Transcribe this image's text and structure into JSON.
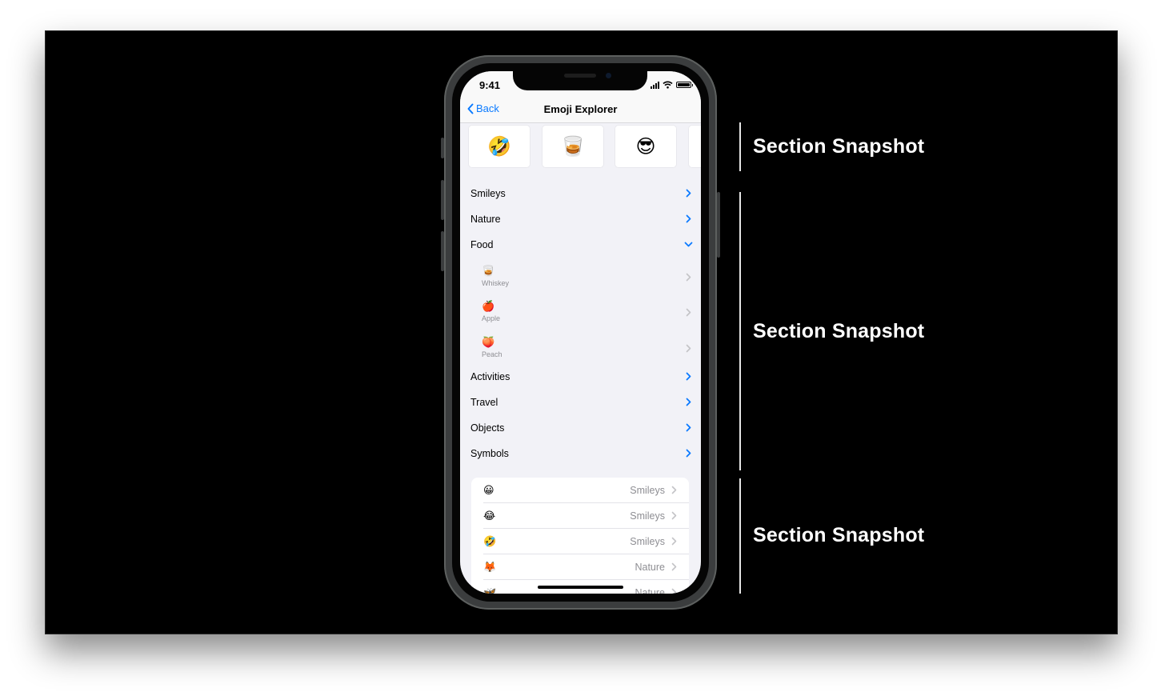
{
  "annotations": {
    "labels": [
      "Section Snapshot",
      "Section Snapshot",
      "Section Snapshot"
    ]
  },
  "phone": {
    "status_time": "9:41",
    "nav": {
      "back_label": "Back",
      "title": "Emoji Explorer"
    },
    "snapshot_cards": [
      "🤣",
      "🥃",
      "😎"
    ],
    "categories": [
      "Smileys",
      "Nature",
      "Food",
      "Activities",
      "Travel",
      "Objects",
      "Symbols"
    ],
    "food_items": [
      {
        "emoji": "🥃",
        "name": "Whiskey"
      },
      {
        "emoji": "🍎",
        "name": "Apple"
      },
      {
        "emoji": "🍑",
        "name": "Peach"
      }
    ],
    "list_rows": [
      {
        "emoji": "😀",
        "category": "Smileys"
      },
      {
        "emoji": "😂",
        "category": "Smileys"
      },
      {
        "emoji": "🤣",
        "category": "Smileys"
      },
      {
        "emoji": "🦊",
        "category": "Nature"
      },
      {
        "emoji": "🦋",
        "category": "Nature"
      }
    ]
  },
  "colors": {
    "accent": "#0a7aff",
    "background": "#000000",
    "screen_bg": "#f2f2f7"
  },
  "icons": [
    "chevron-left-icon",
    "chevron-right-icon",
    "chevron-down-icon",
    "signal-icon",
    "wifi-icon",
    "battery-icon"
  ]
}
